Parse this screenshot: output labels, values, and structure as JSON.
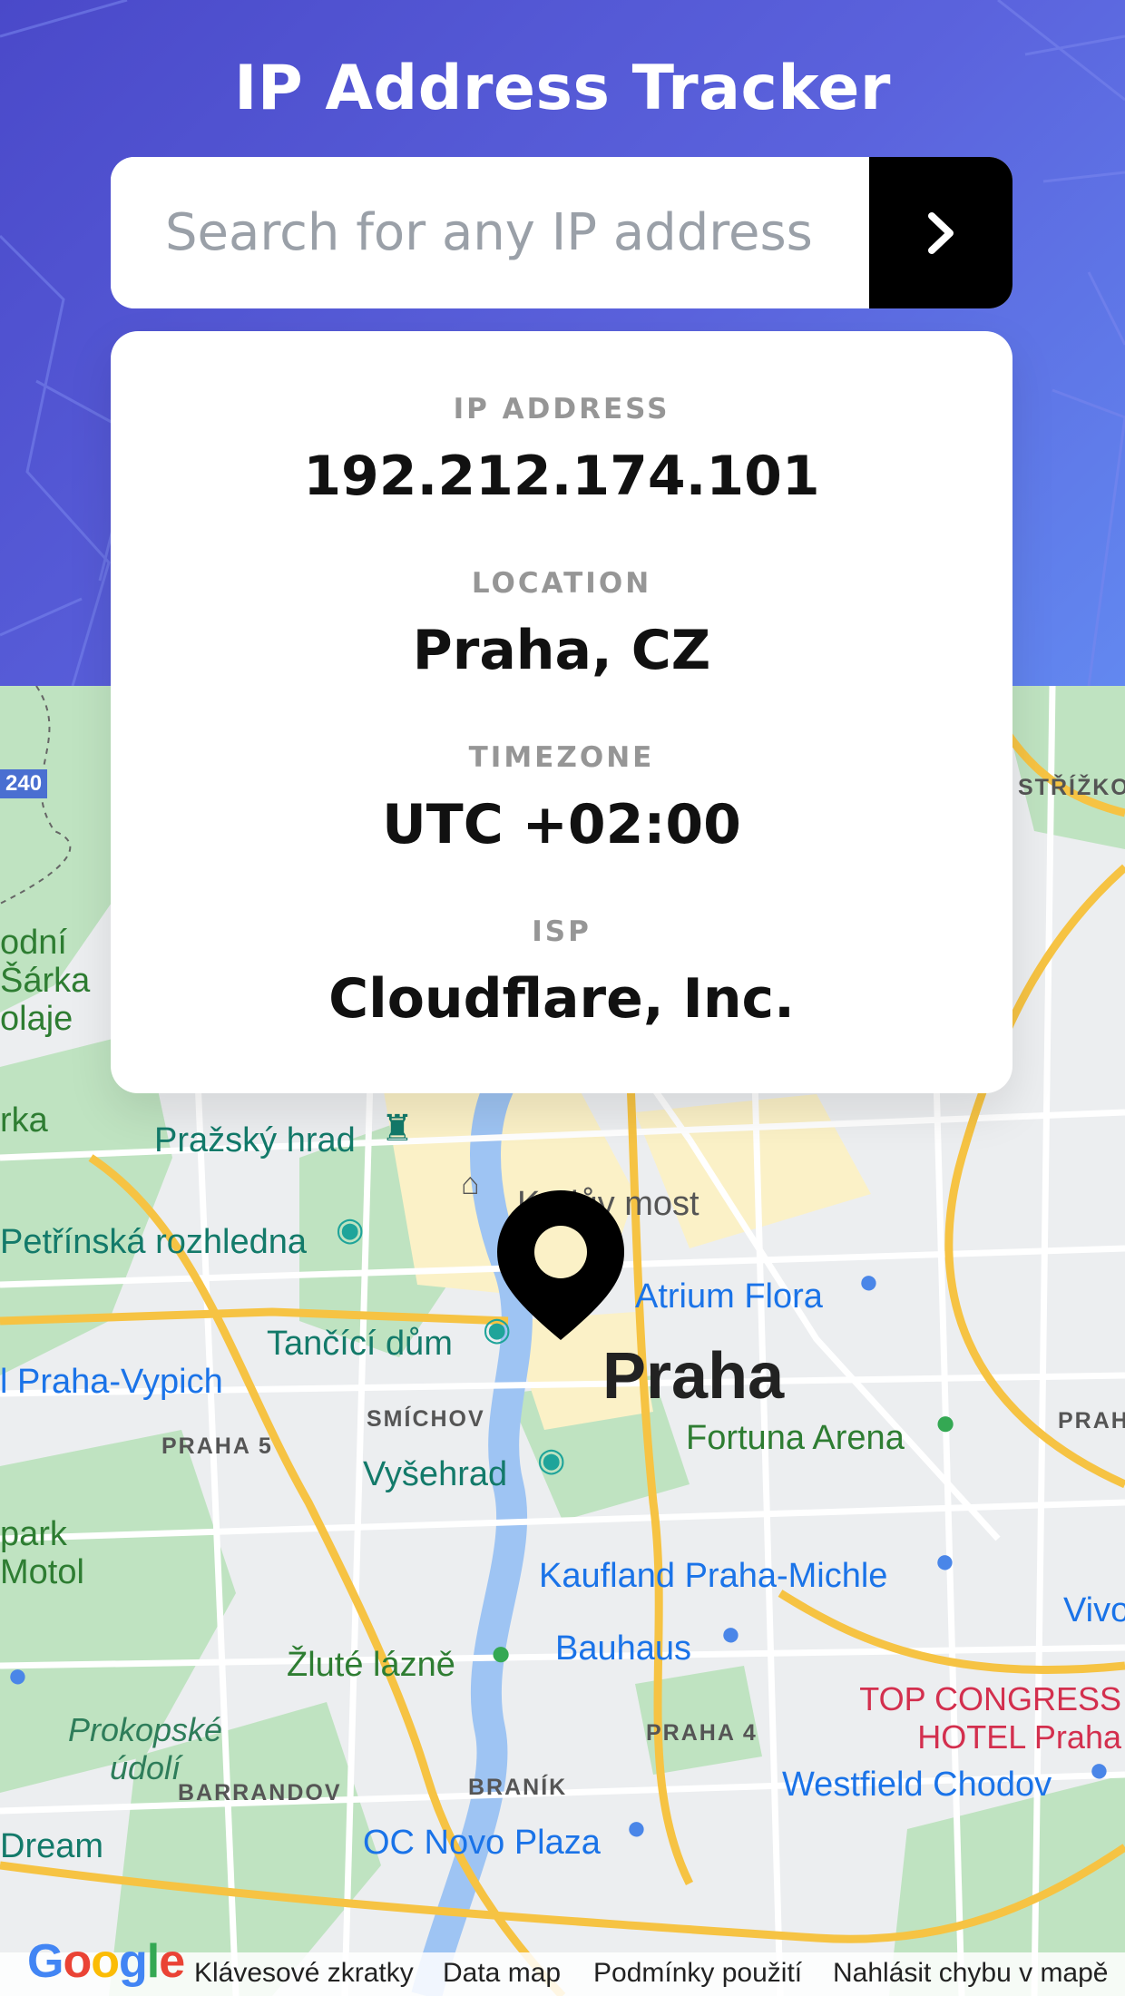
{
  "header": {
    "title": "IP Address Tracker"
  },
  "search": {
    "placeholder": "Search for any IP address",
    "value": "",
    "button_icon": "chevron-right-icon"
  },
  "info": {
    "ip_label": "IP ADDRESS",
    "ip_value": "192.212.174.101",
    "location_label": "LOCATION",
    "location_value": "Praha, CZ",
    "timezone_label": "TIMEZONE",
    "timezone_value": "UTC +02:00",
    "isp_label": "ISP",
    "isp_value": "Cloudflare, Inc."
  },
  "map": {
    "city": "Praha",
    "road_number": "240",
    "places": {
      "prazsky_hrad": "Pražský hrad",
      "karluv_most": "Karlův most",
      "petrinska": "Petřínská rozhledna",
      "atrium_flora": "Atrium Flora",
      "tancici_dum": "Tančící dům",
      "praha_vypich": "l Praha-Vypich",
      "smichov": "SMÍCHOV",
      "praha5": "PRAHA 5",
      "fortuna_arena": "Fortuna Arena",
      "praha_right": "PRAHA",
      "vysehrad": "Vyšehrad",
      "park_motol_1": "park",
      "park_motol_2": "Motol",
      "kaufland": "Kaufland Praha-Michle",
      "vivo": "Vivo",
      "bauhaus": "Bauhaus",
      "zlute_lazne": "Žluté lázně",
      "prokopske_1": "Prokopské",
      "prokopske_2": "údolí",
      "praha4": "PRAHA 4",
      "top_congress_1": "TOP CONGRESS",
      "top_congress_2": "HOTEL Praha",
      "barrandov": "BARRANDOV",
      "branik": "BRANÍK",
      "westfield": "Westfield Chodov",
      "oc_novo": "OC Novo Plaza",
      "dream": "Dream",
      "strizkov": "STŘÍŽKO",
      "sarka_1": "odní",
      "sarka_2": "Šárka",
      "sarka_3": "olaje",
      "rka": "rka"
    },
    "footer": {
      "logo": "Google",
      "shortcuts": "Klávesové zkratky",
      "data": "Data map",
      "terms": "Podmínky použití",
      "report": "Nahlásit chybu v mapě"
    },
    "colors": {
      "water": "#9ec4f3",
      "park": "#b7dfb9",
      "road_major": "#f6c343",
      "urban": "#fbf1c7",
      "marker": "#000000"
    }
  }
}
